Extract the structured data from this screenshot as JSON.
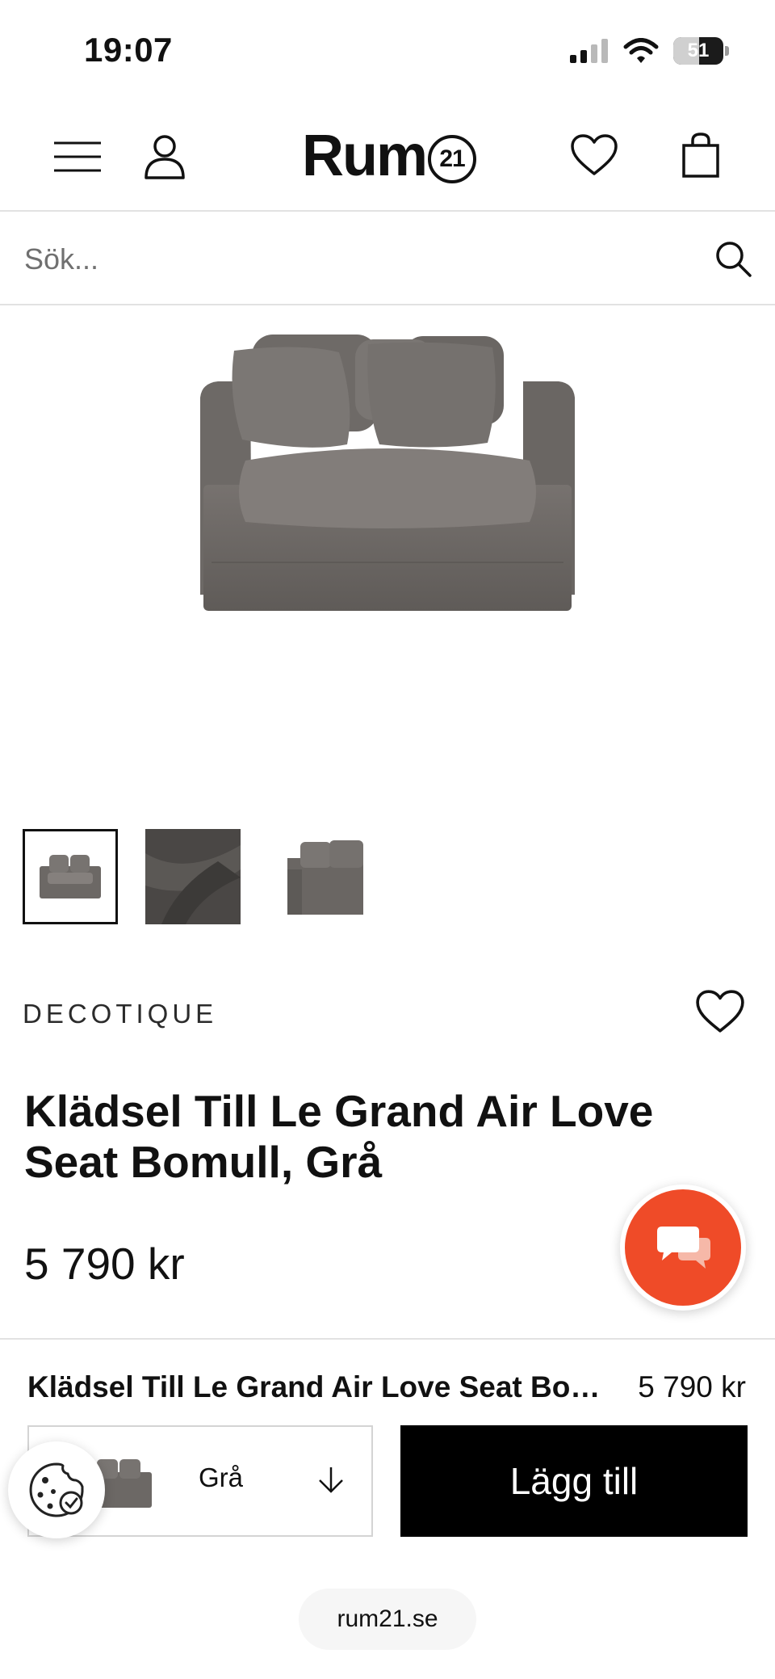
{
  "status_bar": {
    "time": "19:07",
    "battery_percent": "51",
    "battery_level": 0.51
  },
  "header": {
    "logo_text": "Rum",
    "logo_badge": "21",
    "menu_icon": "hamburger-menu-icon",
    "account_icon": "user-icon",
    "wishlist_icon": "heart-icon",
    "cart_icon": "shopping-bag-icon"
  },
  "search": {
    "placeholder": "Sök...",
    "icon": "search-icon"
  },
  "gallery": {
    "thumbnail_count": 3,
    "active_index": 0
  },
  "product": {
    "brand": "DECOTIQUE",
    "title": "Klädsel Till Le Grand Air Love Seat Bomull, Grå",
    "price": "5 790 kr"
  },
  "sticky_bar": {
    "title": "Klädsel Till Le Grand Air Love Seat Bomull, Grå",
    "price": "5 790 kr",
    "variant_value": "Grå",
    "add_button_label": "Lägg till"
  },
  "browser": {
    "url": "rum21.se"
  },
  "colors": {
    "chat_button": "#ef4b28",
    "add_button_bg": "#000000",
    "sofa_grey": "#6e6a67"
  }
}
